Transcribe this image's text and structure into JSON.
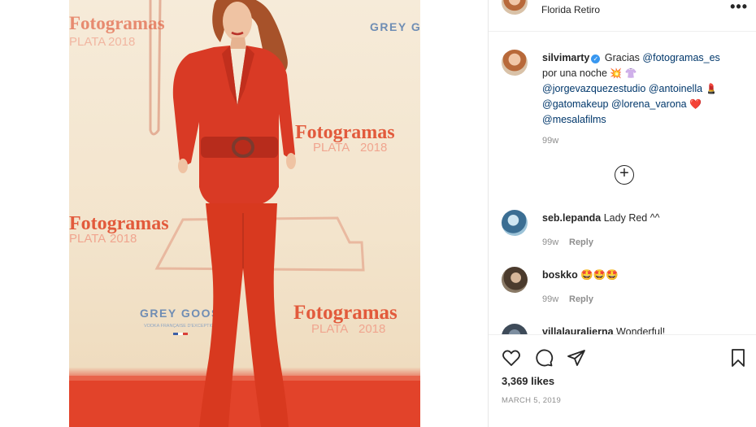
{
  "post": {
    "location": "Florida Retiro",
    "more_label": "•••",
    "photo": {
      "sponsor_text": "GREY GOOSE",
      "sponsor_subtext": "VODKA FRANÇAISE D'EXCEPTION",
      "brand_text": "Fotogramas",
      "brand_sub": "PLATA",
      "brand_year": "2018",
      "sponsor_text_partial": "GREY G",
      "brand_text_partial": "Fotogramas"
    },
    "caption": {
      "username": "silvimarty",
      "verified_mark": "✓",
      "text_1": "Gracias",
      "mention_1": "@fotogramas_es",
      "text_2": "por una noche",
      "emoji_1": "💥",
      "emoji_2": "👚",
      "mention_2": "@jorgevazquezestudio",
      "mention_3": "@antoinella",
      "emoji_3": "💄",
      "mention_4": "@gatomakeup",
      "mention_5": "@lorena_varona",
      "emoji_4": "❤️",
      "mention_6": "@mesalafilms",
      "time": "99w"
    },
    "load_more_label": "+",
    "comments": [
      {
        "username": "seb.lepanda",
        "text": "Lady Red ^^",
        "time": "99w",
        "reply": "Reply"
      },
      {
        "username": "boskko",
        "text": "🤩🤩🤩",
        "time": "99w",
        "reply": "Reply"
      },
      {
        "username": "villalauralierna",
        "text": "Wonderful!"
      }
    ],
    "likes": "3,369 likes",
    "date": "MARCH 5, 2019"
  }
}
